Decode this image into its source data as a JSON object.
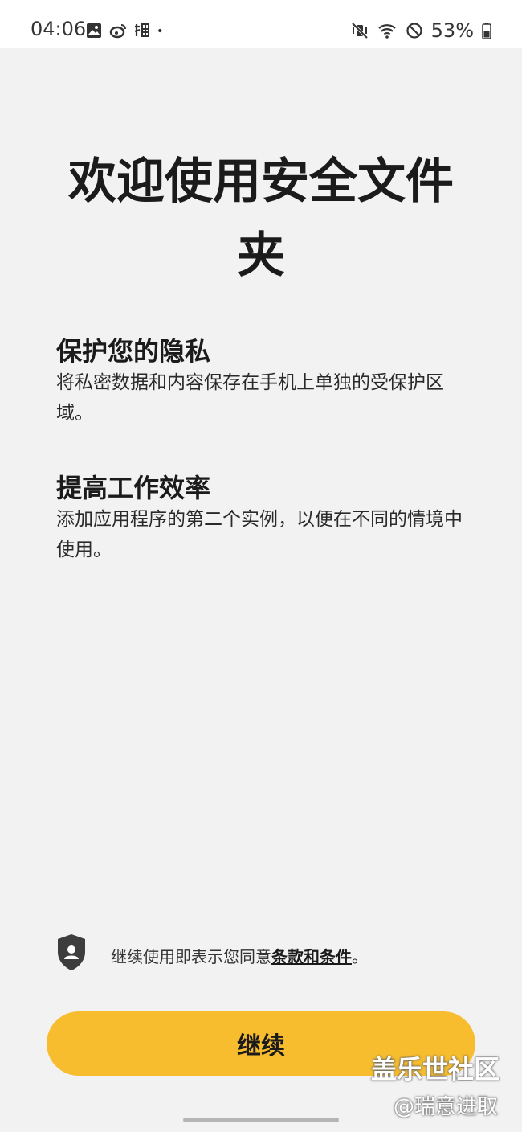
{
  "status_bar": {
    "time": "04:06",
    "battery": "53%",
    "left_icons": [
      "gallery-icon",
      "weibo-icon",
      "taobao-icon",
      "dot-icon"
    ],
    "right_icons": [
      "vibrate-mute-icon",
      "wifi-icon",
      "dnd-icon",
      "battery-icon"
    ]
  },
  "main": {
    "title_line1": "欢迎使用安全文件",
    "title_line2": "夹",
    "features": [
      {
        "heading": "保护您的隐私",
        "body": "将私密数据和内容保存在手机上单独的受保护区域。"
      },
      {
        "heading": "提高工作效率",
        "body": "添加应用程序的第二个实例，以便在不同的情境中使用。"
      }
    ]
  },
  "terms": {
    "prefix": "继续使用即表示您同意",
    "link": "条款和条件",
    "suffix": "。"
  },
  "actions": {
    "continue_label": "继续"
  },
  "watermark": {
    "line1": "盖乐世社区",
    "line2": "@瑞意进取"
  },
  "colors": {
    "accent": "#f7bd2f",
    "background": "#f2f2f2"
  }
}
